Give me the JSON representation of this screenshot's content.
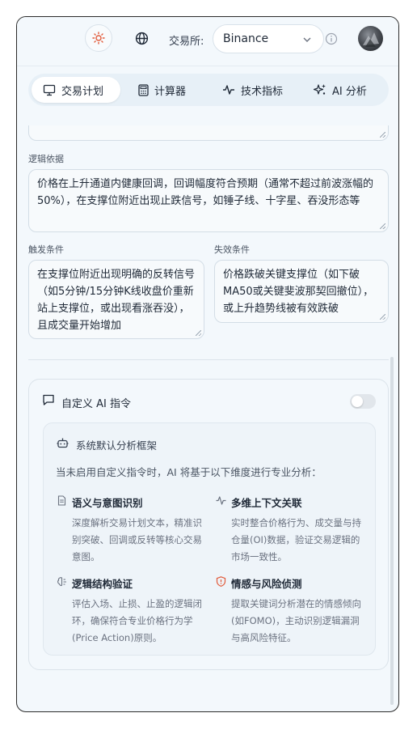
{
  "header": {
    "exchange_label": "交易所:",
    "exchange_value": "Binance"
  },
  "tabs": [
    {
      "label": "交易计划",
      "icon": "monitor-icon",
      "active": true
    },
    {
      "label": "计算器",
      "icon": "calculator-icon",
      "active": false
    },
    {
      "label": "技术指标",
      "icon": "activity-icon",
      "active": false
    },
    {
      "label": "AI 分析",
      "icon": "sparkles-icon",
      "active": false
    }
  ],
  "plan": {
    "logic_label": "逻辑依据",
    "logic_text": "价格在上升通道内健康回调，回调幅度符合预期（通常不超过前波涨幅的50%），在支撑位附近出现止跌信号，如锤子线、十字星、吞没形态等",
    "trigger_label": "触发条件",
    "trigger_text": "在支撑位附近出现明确的反转信号（如5分钟/15分钟K线收盘价重新站上支撑位，或出现看涨吞没），且成交量开始增加",
    "invalid_label": "失效条件",
    "invalid_text": "价格跌破关键支撑位（如下破MA50或关键斐波那契回撤位），或上升趋势线被有效跌破"
  },
  "custom_ai": {
    "title": "自定义 AI 指令",
    "toggle_on": false,
    "framework_title": "系统默认分析框架",
    "framework_intro": "当未启用自定义指令时，AI 将基于以下维度进行专业分析：",
    "features": [
      {
        "title": "语义与意图识别",
        "icon": "file-icon",
        "desc": "深度解析交易计划文本，精准识别突破、回调或反转等核心交易意图。"
      },
      {
        "title": "多维上下文关联",
        "icon": "pulse-icon",
        "desc": "实时整合价格行为、成交量与持仓量(OI)数据，验证交易逻辑的市场一致性。"
      },
      {
        "title": "逻辑结构验证",
        "icon": "brain-icon",
        "desc": "评估入场、止损、止盈的逻辑闭环，确保符合专业价格行为学(Price Action)原则。"
      },
      {
        "title": "情感与风险侦测",
        "icon": "shield-alert-icon",
        "desc": "提取关键词分析潜在的情感倾向(如FOMO)，主动识别逻辑漏洞与高风险特征。"
      }
    ]
  },
  "colors": {
    "accent_orange": "#e25a3a",
    "background": "#f3f8fc"
  }
}
